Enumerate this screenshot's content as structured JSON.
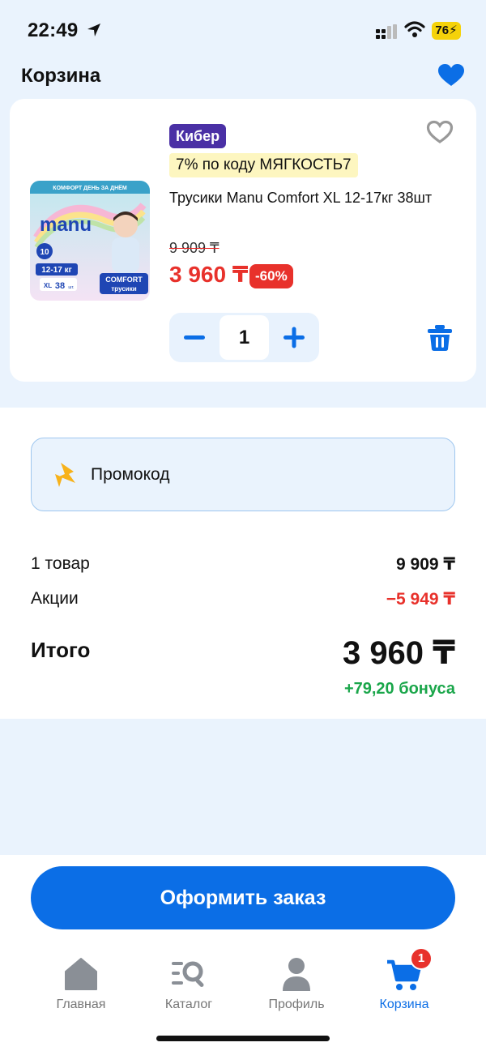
{
  "status_bar": {
    "time": "22:49",
    "battery": "76"
  },
  "header": {
    "title": "Корзина"
  },
  "cart_item": {
    "badge": "Кибер",
    "promo_tag": "7% по коду МЯГКОСТЬ7",
    "title": "Трусики Manu Comfort XL 12-17кг 38шт",
    "old_price": "9 909 ₸",
    "new_price": "3 960 ₸",
    "discount": "-60%",
    "quantity": "1",
    "image": {
      "brand": "manu",
      "top_text": "КОМФОРТ ДЕНЬ ЗА ДНЁМ",
      "weight": "12-17 кг",
      "size": "XL",
      "count": "38",
      "count_unit": "шт.",
      "line1": "COMFORT",
      "line2": "трусики",
      "layers": "10"
    }
  },
  "promo": {
    "label": "Промокод"
  },
  "summary": {
    "items_label": "1 товар",
    "items_value": "9 909 ₸",
    "promo_label": "Акции",
    "promo_value": "−5 949 ₸",
    "total_label": "Итого",
    "total_value": "3 960 ₸",
    "bonus": "+79,20 бонуса"
  },
  "checkout": {
    "label": "Оформить заказ"
  },
  "nav": {
    "items": [
      {
        "label": "Главная",
        "icon": "home-icon"
      },
      {
        "label": "Каталог",
        "icon": "catalog-search-icon"
      },
      {
        "label": "Профиль",
        "icon": "profile-icon"
      },
      {
        "label": "Корзина",
        "icon": "cart-icon"
      }
    ],
    "cart_count": "1"
  },
  "colors": {
    "accent": "#0b6ee6",
    "price_red": "#e8312b",
    "bonus_green": "#1aa64a",
    "badge_purple": "#4a30a5",
    "background": "#eaf3fd"
  }
}
